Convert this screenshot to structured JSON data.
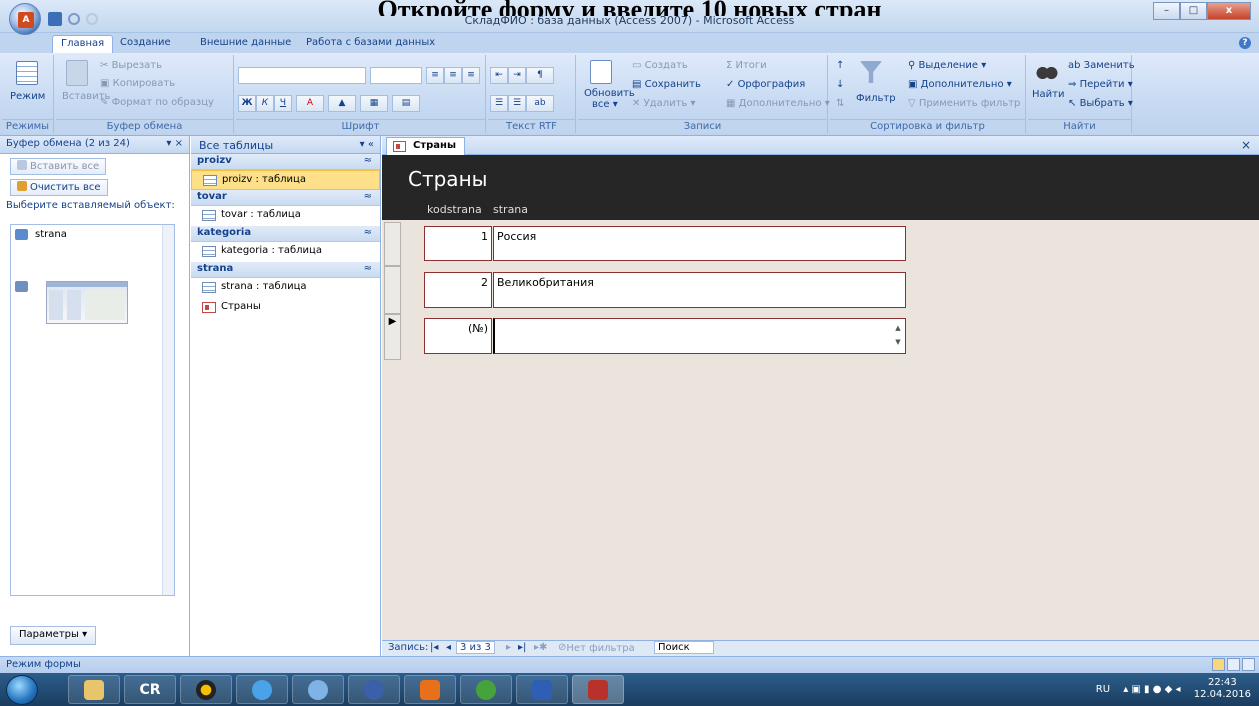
{
  "banner": {
    "text": "Откройте форму и введите 10 новых стран"
  },
  "window": {
    "title": "СкладФИО : база данных (Access 2007) - Microsoft Access",
    "minimize": "–",
    "maximize": "□",
    "close": "x"
  },
  "ribbon_tabs": [
    "Главная",
    "Создание",
    "Внешние данные",
    "Работа с базами данных"
  ],
  "help": "?",
  "ribbon": {
    "views": {
      "mode": "Режим",
      "label": "Режимы"
    },
    "clipboard": {
      "paste": "Вставить",
      "cut": "Вырезать",
      "copy": "Копировать",
      "format": "Формат по образцу",
      "label": "Буфер обмена"
    },
    "font": {
      "bold": "Ж",
      "italic": "К",
      "underline": "Ч",
      "label": "Шрифт"
    },
    "rtf": {
      "label": "Текст RTF"
    },
    "records": {
      "refresh": "Обновить",
      "refresh2": "все ▾",
      "new": "Создать",
      "save": "Сохранить",
      "delete": "Удалить ▾",
      "totals": "Итоги",
      "spelling": "Орфография",
      "more": "Дополнительно ▾",
      "label": "Записи"
    },
    "sort": {
      "filter": "Фильтр",
      "selection": "Выделение ▾",
      "advanced": "Дополнительно ▾",
      "apply": "Применить фильтр",
      "label": "Сортировка и фильтр"
    },
    "find": {
      "find": "Найти",
      "replace": "Заменить",
      "goto": "Перейти ▾",
      "select": "Выбрать ▾",
      "label": "Найти"
    }
  },
  "clipboard_pane": {
    "title": "Буфер обмена (2 из 24)",
    "controls": "▾ ×",
    "paste_all": "Вставить все",
    "clear_all": "Очистить все",
    "prompt": "Выберите вставляемый объект:",
    "items": [
      "strana"
    ],
    "options": "Параметры ▾"
  },
  "nav_pane": {
    "title": "Все таблицы",
    "controls": "▾ «",
    "groups": [
      {
        "name": "proizv",
        "items": [
          {
            "label": "proizv : таблица",
            "type": "table",
            "selected": true
          }
        ]
      },
      {
        "name": "tovar",
        "items": [
          {
            "label": "tovar : таблица",
            "type": "table"
          }
        ]
      },
      {
        "name": "kategoria",
        "items": [
          {
            "label": "kategoria : таблица",
            "type": "table"
          }
        ]
      },
      {
        "name": "strana",
        "items": [
          {
            "label": "strana : таблица",
            "type": "table"
          },
          {
            "label": "Страны",
            "type": "form"
          }
        ]
      }
    ],
    "collapse": "≈"
  },
  "document": {
    "tab": "Страны",
    "close": "×",
    "form_title": "Страны",
    "columns": [
      "kodstrana",
      "strana"
    ],
    "rows": [
      {
        "kodstrana": "1",
        "strana": "Россия"
      },
      {
        "kodstrana": "2",
        "strana": "Великобритания"
      },
      {
        "kodstrana": "(№)",
        "strana": ""
      }
    ],
    "current_marker": "▶"
  },
  "record_nav": {
    "label": "Запись:",
    "first": "|◂",
    "prev": "◂",
    "position": "3 из 3",
    "next": "▸",
    "last": "▸|",
    "new": "▸✱",
    "filter": "Нет фильтра",
    "search": "Поиск"
  },
  "status": {
    "text": "Режим формы"
  },
  "taskbar": {
    "cr": "CR",
    "lang": "RU",
    "time": "22:43",
    "date": "12.04.2016"
  },
  "colors": {
    "accent": "#15428b",
    "ribbon": "#c4d8f1",
    "form_header": "#262626",
    "field_border": "#8b3030",
    "doc_bg": "#ebe4dc"
  }
}
